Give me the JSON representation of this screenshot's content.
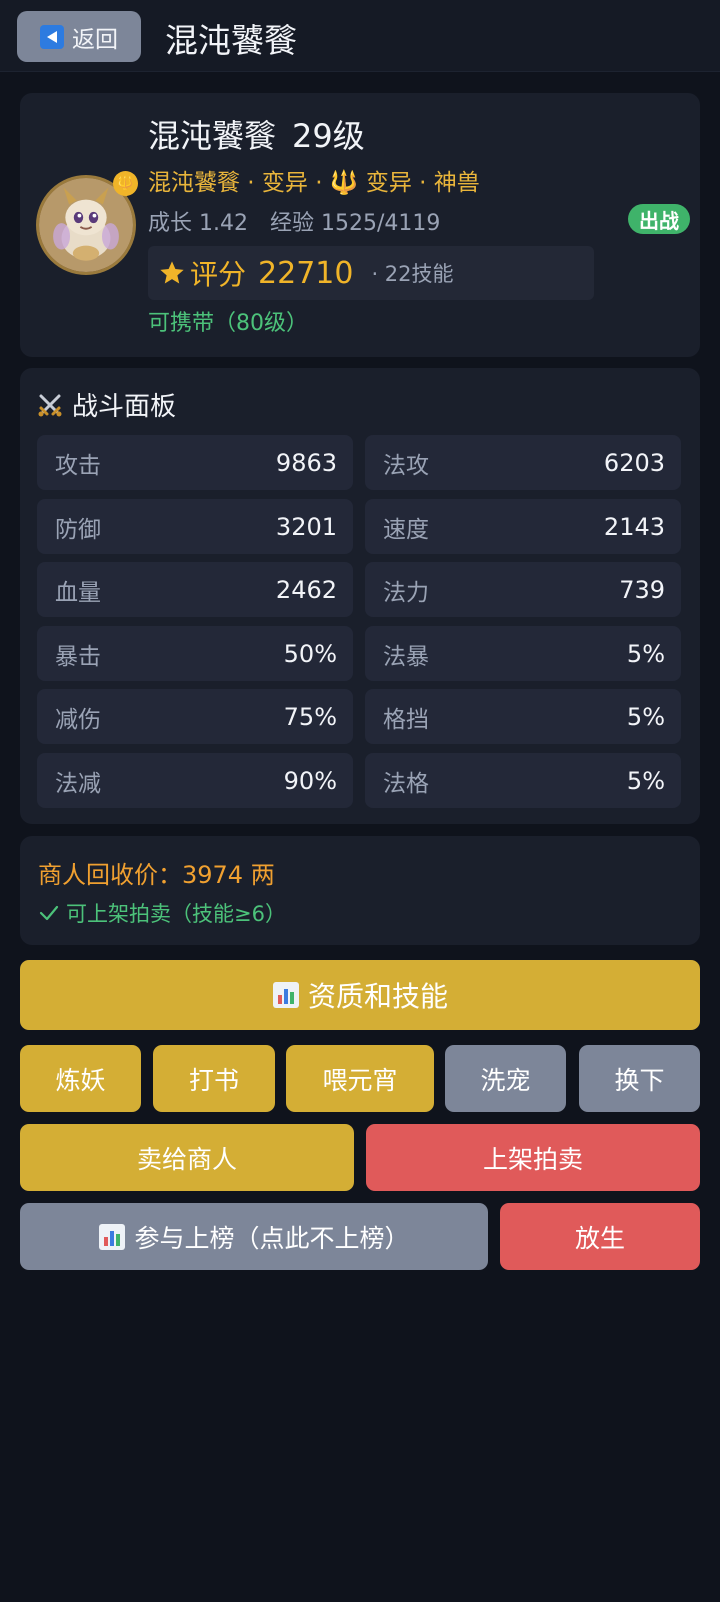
{
  "header": {
    "back_label": "返回",
    "title": "混沌饕餮"
  },
  "pet": {
    "name": "混沌饕餮",
    "level": "29级",
    "type_line": "混沌饕餮 · 变异 · 🔱 变异 · 神兽",
    "badge_glyph": "🔱",
    "growth": "成长 1.42",
    "exp": "经验 1525/4119",
    "status_badge": "出战",
    "score_label": "评分",
    "score_value": "22710",
    "skill_count": "· 22技能",
    "carry": "可携带（80级）"
  },
  "battle": {
    "title": "战斗面板",
    "stats": [
      {
        "label": "攻击",
        "value": "9863"
      },
      {
        "label": "法攻",
        "value": "6203"
      },
      {
        "label": "防御",
        "value": "3201"
      },
      {
        "label": "速度",
        "value": "2143"
      },
      {
        "label": "血量",
        "value": "2462"
      },
      {
        "label": "法力",
        "value": "739"
      },
      {
        "label": "暴击",
        "value": "50%"
      },
      {
        "label": "法暴",
        "value": "5%"
      },
      {
        "label": "减伤",
        "value": "75%"
      },
      {
        "label": "格挡",
        "value": "5%"
      },
      {
        "label": "法减",
        "value": "90%"
      },
      {
        "label": "法格",
        "value": "5%"
      }
    ]
  },
  "merchant": {
    "price": "商人回收价：3974 两",
    "auction_ok": "可上架拍卖（技能≥6）"
  },
  "actions": {
    "aptitude_skills": "资质和技能",
    "refine": "炼妖",
    "book": "打书",
    "feed": "喂元宵",
    "wash": "洗宠",
    "swap": "换下",
    "sell_merchant": "卖给商人",
    "list_auction": "上架拍卖",
    "leaderboard": "参与上榜（点此不上榜）",
    "release": "放生"
  },
  "colors": {
    "background": "#0f131c",
    "card": "#1a1f2b",
    "gold": "#d4ae35",
    "gray": "#7d8699",
    "red": "#e05a5a",
    "green": "#4cc27a",
    "orange": "#f0a030"
  },
  "icons": {
    "back": "back-triangle-icon",
    "star": "star-icon",
    "swords": "crossed-swords-icon",
    "check": "check-icon",
    "chart": "bar-chart-icon"
  }
}
